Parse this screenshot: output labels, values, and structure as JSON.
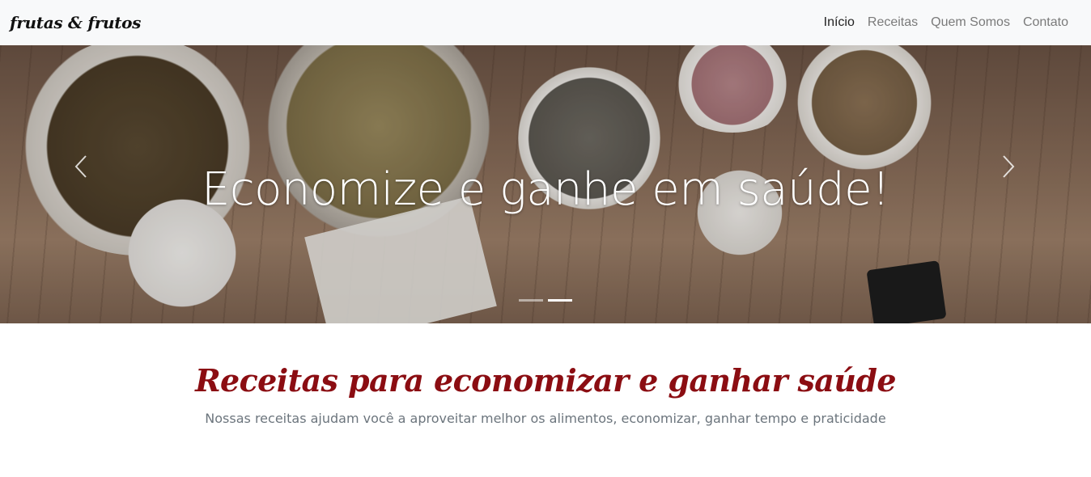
{
  "navbar": {
    "brand": "frutas & frutos",
    "links": [
      {
        "label": "Início",
        "active": true
      },
      {
        "label": "Receitas",
        "active": false
      },
      {
        "label": "Quem Somos",
        "active": false
      },
      {
        "label": "Contato",
        "active": false
      }
    ]
  },
  "carousel": {
    "caption": "Economize e ganhe em saúde!",
    "prev_icon": "chevron-left-icon",
    "next_icon": "chevron-right-icon",
    "slide_count": 2,
    "active_slide": 2
  },
  "hero": {
    "title": "Receitas para economizar e ganhar saúde",
    "subtitle": "Nossas receitas ajudam você a aproveitar melhor os alimentos, economizar, ganhar tempo e praticidade"
  },
  "colors": {
    "title_red": "#8b0d12",
    "navbar_bg": "#f8f9fa",
    "subtitle_gray": "#6c757d"
  }
}
